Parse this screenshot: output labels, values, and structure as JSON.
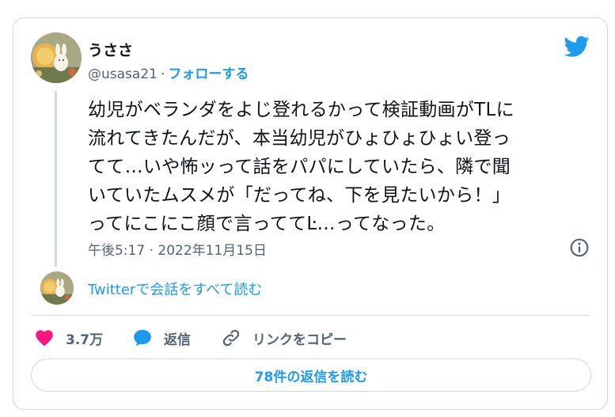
{
  "author": {
    "name": "うささ\u0000",
    "display_name": "うささ",
    "handle": "@usasa21",
    "separator": "·",
    "follow_label": "フォローする"
  },
  "tweet": {
    "text": "幼児がベランダをよじ登れるかって検証動画がTLに\n流れてきたんだが、本当幼児がひょひょひょい登っ\nてて…いや怖ッって話をパパにしていたら、隣で聞\nいていたムスメが「だってね、下を見たいから！」\nってにこにこ顔で言っててĿ…ってなった。",
    "timestamp": "午後5:17 · 2022年11月15日"
  },
  "conversation": {
    "link_label": "Twitterで会話をすべて読む"
  },
  "actions": {
    "likes_count": "3.7万",
    "reply_label": "返信",
    "copy_label": "リンクをコピー"
  },
  "read_replies_label": "78件の返信を読む",
  "colors": {
    "accent": "#1d9bf0",
    "like": "#f91880",
    "muted": "#536471",
    "border": "#cfd9de"
  },
  "icons": {
    "brand": "twitter-bird-icon",
    "info": "info-icon",
    "like": "heart-icon",
    "reply": "reply-bubble-icon",
    "copy": "link-icon"
  }
}
